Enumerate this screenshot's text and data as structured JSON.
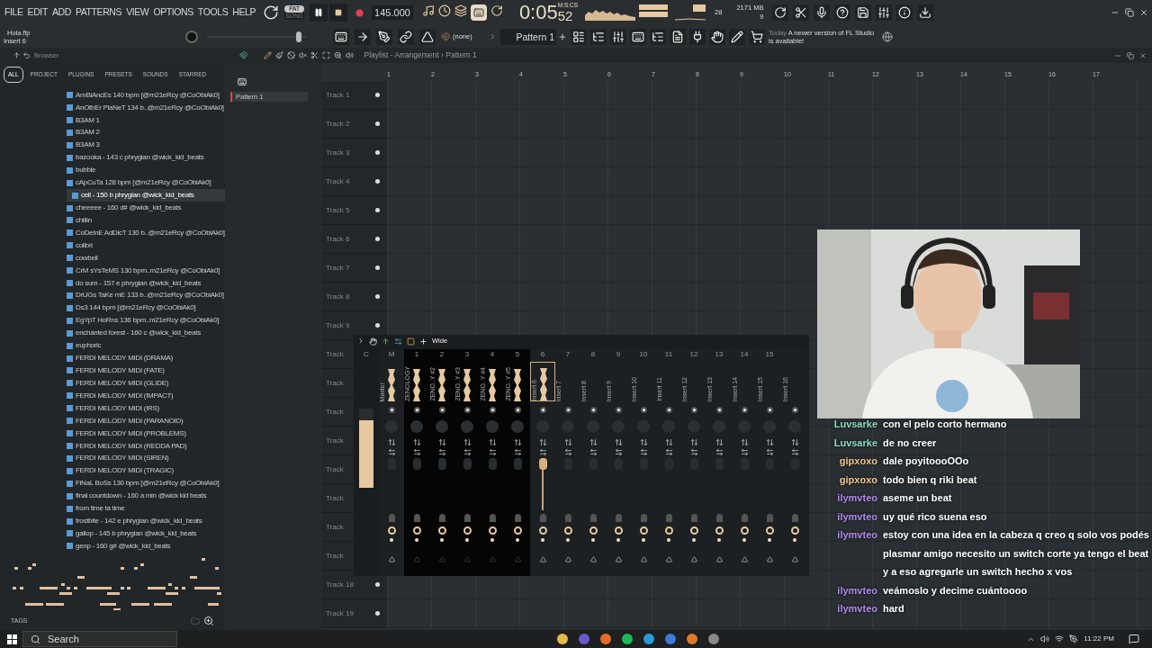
{
  "menu": [
    "FILE",
    "EDIT",
    "ADD",
    "PATTERNS",
    "VIEW",
    "OPTIONS",
    "TOOLS",
    "HELP"
  ],
  "transport": {
    "modes": [
      {
        "label": "PAT",
        "selected": true
      },
      {
        "label": "SONG",
        "selected": false
      }
    ],
    "tempo": "145.000",
    "time_main": "0:05",
    "time_cs": "52",
    "time_unit": "M:S:CS"
  },
  "monitor": {
    "cpu": "28",
    "memory": "2171 MB",
    "polyphony": "9"
  },
  "project": {
    "file": "Hola.flp",
    "hint": "Insert 6"
  },
  "pattern_selector": {
    "snap": "(none)",
    "pattern": "Pattern 1"
  },
  "news": {
    "date": "Today",
    "text": "A newer version of FL Studio is available!"
  },
  "browser": {
    "title": "Browser",
    "tabs": [
      {
        "label": "ALL",
        "selected": true
      },
      {
        "label": "PROJECT",
        "selected": false
      },
      {
        "label": "PLUGINS",
        "selected": false
      },
      {
        "label": "PRESETS",
        "selected": false
      },
      {
        "label": "SOUNDS",
        "selected": false
      },
      {
        "label": "STARRED",
        "selected": false
      }
    ],
    "items": [
      {
        "label": "AmBiAncEs 140 bpm [@m21eRcy @CoObiAk0]",
        "selected": false
      },
      {
        "label": "AnOthEr PlaNeT 134 b..@m21eRcy @CoObiAk0]",
        "selected": false
      },
      {
        "label": "B3AM 1",
        "selected": false
      },
      {
        "label": "B3AM 2",
        "selected": false
      },
      {
        "label": "B3AM 3",
        "selected": false
      },
      {
        "label": "bazooka - 143 c phrygian @wick_kid_beats",
        "selected": false
      },
      {
        "label": "bubble",
        "selected": false
      },
      {
        "label": "cApCuTa 128 bpm [@m21eRcy @CoObiAk0]",
        "selected": false
      },
      {
        "label": "cell - 150 b phrygian @wick_kid_beats",
        "selected": true
      },
      {
        "label": "cheeeee - 160 d# @wick_kid_beats",
        "selected": false
      },
      {
        "label": "chillin",
        "selected": false
      },
      {
        "label": "CoDeInE AdDicT 130 b..@m21eRcy @CoObiAk0]",
        "selected": false
      },
      {
        "label": "colibri",
        "selected": false
      },
      {
        "label": "cowbell",
        "selected": false
      },
      {
        "label": "CrM sYsTeMS 130 bpm..m21eRcy @CoObiAk0]",
        "selected": false
      },
      {
        "label": "do sum - 157 e phrygian @wick_kid_beats",
        "selected": false
      },
      {
        "label": "DrUGs TaKe mE 133 b..@m21eRcy @CoObiAk0]",
        "selected": false
      },
      {
        "label": "Ds3 144 bpm [@m21eRcy @CoObiAk0]",
        "selected": false
      },
      {
        "label": "EgYpT HoRns 136 bpm..m21eRcy @CoObiAk0]",
        "selected": false
      },
      {
        "label": "enchanted forest - 160 c @wick_kid_beats",
        "selected": false
      },
      {
        "label": "euphoric",
        "selected": false
      },
      {
        "label": "FERDI MELODY MIDI (DRAMA)",
        "selected": false
      },
      {
        "label": "FERDI MELODY MIDI (FATE)",
        "selected": false
      },
      {
        "label": "FERDI MELODY MIDI (GLIDE)",
        "selected": false
      },
      {
        "label": "FERDI MELODY MIDI (IMPACT)",
        "selected": false
      },
      {
        "label": "FERDI MELODY MIDI (IRS)",
        "selected": false
      },
      {
        "label": "FERDI MELODY MIDI (PARANOID)",
        "selected": false
      },
      {
        "label": "FERDI MELODY MIDI (PROBLEMS)",
        "selected": false
      },
      {
        "label": "FERDI MELODY MIDI (REDDA PAD)",
        "selected": false
      },
      {
        "label": "FERDI MELODY MIDI (SIREN)",
        "selected": false
      },
      {
        "label": "FERDI MELODY MIDI (TRAGIC)",
        "selected": false
      },
      {
        "label": "FiNaL BoSs 130  bpm [@m21eRcy @CoObiAk0]",
        "selected": false
      },
      {
        "label": "final countdown - 160 a min @wick kid beats",
        "selected": false
      },
      {
        "label": "from time ta time",
        "selected": false
      },
      {
        "label": "frostbite - 142 e phrygian @wick_kid_beats",
        "selected": false
      },
      {
        "label": "gallop - 145 b phrygian @wick_kid_beats",
        "selected": false
      },
      {
        "label": "genp - 160 g# @wick_kid_beats",
        "selected": false
      }
    ],
    "tags_label": "TAGS"
  },
  "channel_rack": {
    "patterns": [
      {
        "label": "Pattern 1",
        "selected": true
      }
    ]
  },
  "song_position": {
    "level": 0.95
  },
  "playlist": {
    "title": "Playlist - Arrangement",
    "separator": "›",
    "pattern": "Pattern 1",
    "bars": [
      "1",
      "2",
      "3",
      "4",
      "5",
      "6",
      "7",
      "8",
      "9",
      "10",
      "11",
      "12",
      "13",
      "14",
      "15",
      "16",
      "17"
    ],
    "tracks": [
      "Track 1",
      "Track 2",
      "Track 3",
      "Track 4",
      "Track 5",
      "Track 6",
      "Track 7",
      "Track 8",
      "Track 9",
      "Track",
      "Track",
      "Track",
      "Track",
      "Track",
      "Track",
      "Track",
      "Track",
      "Track 18",
      "Track 19"
    ]
  },
  "mixer": {
    "view": "Wide",
    "master_meter": {
      "label": "C",
      "level": 0.85
    },
    "strips": [
      {
        "kind": "master",
        "number": "M",
        "name": "Master",
        "selected": false
      },
      {
        "kind": "instrument",
        "number": "1",
        "name": "ZENOLOGY",
        "selected": false
      },
      {
        "kind": "instrument",
        "number": "2",
        "name": "ZENO..Y #2",
        "selected": false
      },
      {
        "kind": "instrument",
        "number": "3",
        "name": "ZENO..Y #3",
        "selected": false
      },
      {
        "kind": "instrument",
        "number": "4",
        "name": "ZENO..Y #4",
        "selected": false
      },
      {
        "kind": "instrument",
        "number": "5",
        "name": "ZENO..Y #5",
        "selected": false
      },
      {
        "kind": "insert",
        "number": "6",
        "name": "Insert 6",
        "selected": true
      },
      {
        "kind": "insert",
        "number": "7",
        "name": "Insert 7",
        "selected": false
      },
      {
        "kind": "insert",
        "number": "8",
        "name": "Insert 8",
        "selected": false
      },
      {
        "kind": "insert",
        "number": "9",
        "name": "Insert 9",
        "selected": false
      },
      {
        "kind": "insert",
        "number": "10",
        "name": "Insert 10",
        "selected": false
      },
      {
        "kind": "insert",
        "number": "11",
        "name": "Insert 11",
        "selected": false
      },
      {
        "kind": "insert",
        "number": "12",
        "name": "Insert 12",
        "selected": false
      },
      {
        "kind": "insert",
        "number": "13",
        "name": "Insert 13",
        "selected": false
      },
      {
        "kind": "insert",
        "number": "14",
        "name": "Insert 14",
        "selected": false
      },
      {
        "kind": "insert",
        "number": "15",
        "name": "Insert 15",
        "selected": false
      },
      {
        "kind": "insert",
        "name": "Insert 16",
        "selected": false
      }
    ]
  },
  "webcam": {
    "kind": "picture"
  },
  "chat": [
    {
      "user": "Luvsarke",
      "color": "#8fdcc0",
      "text": "con el pelo corto hermano"
    },
    {
      "user": "Luvsarke",
      "color": "#8fdcc0",
      "text": "de no creer"
    },
    {
      "user": "gipxoxo",
      "color": "#f2c98a",
      "text": "dale poyitoooOOo"
    },
    {
      "user": "gipxoxo",
      "color": "#f2c98a",
      "text": "todo bien q riki beat"
    },
    {
      "user": "ilymvteo",
      "color": "#b48cf0",
      "text": "aseme un beat"
    },
    {
      "user": "ilymvteo",
      "color": "#b48cf0",
      "text": "uy qué rico suena eso"
    },
    {
      "user": "ilymvteo",
      "color": "#b48cf0",
      "text": "estoy con una idea en la cabeza q creo q solo vos podés plasmar amigo necesito un switch corte ya tengo el beat y a eso agregarle un switch hecho x vos"
    },
    {
      "user": "ilymvteo",
      "color": "#b48cf0",
      "text": "veámoslo y decime cuántoooo"
    },
    {
      "user": "ilymvteo",
      "color": "#b48cf0",
      "text": "hard"
    }
  ],
  "taskbar": {
    "search": "Search",
    "clock": "11:22 PM"
  }
}
